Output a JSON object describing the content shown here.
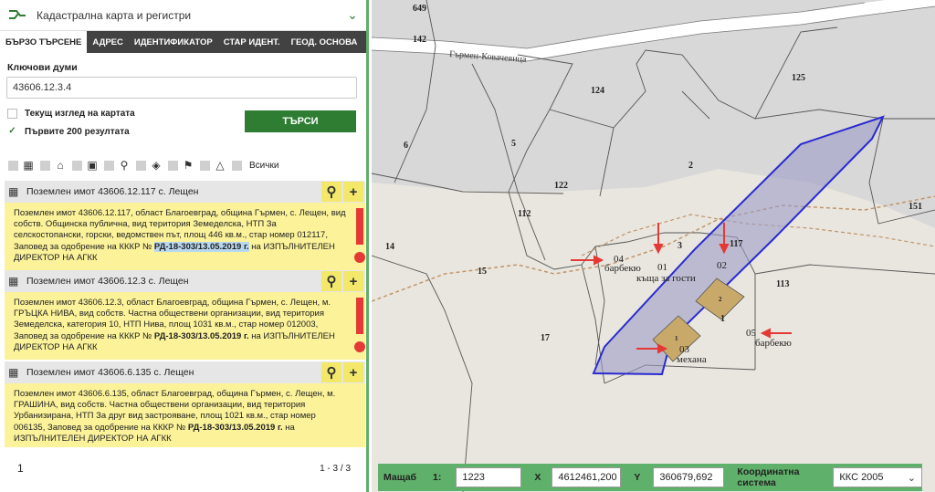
{
  "app": {
    "title": "Кадастрална карта и регистри"
  },
  "tabs": [
    "БЪРЗО ТЪРСЕНЕ",
    "АДРЕС",
    "ИДЕНТИФИКАТОР",
    "СТАР ИДЕНТ.",
    "ГЕОД. ОСНОВА"
  ],
  "search": {
    "keywords_label": "Ключови думи",
    "keywords_value": "43606.12.3.4",
    "current_view_label": "Текущ изглед на картата",
    "first200_label": "Първите 200 резултата",
    "button_label": "ТЪРСИ",
    "filter_all_label": "Всички"
  },
  "results": [
    {
      "title": "Поземлен имот 43606.12.117 с. Лещен",
      "text_a": "Поземлен имот 43606.12.117, област Благоевград, община Гърмен, с. Лещен, вид собств. Общинска публична, вид територия Земеделска, НТП За селскостопански, горски, ведомствен път, площ 446 кв.м., стар номер 012117, Заповед за одобрение на КККР № ",
      "order": "РД-18-303/13.05.2019 г.",
      "text_b": " на ИЗПЪЛНИТЕЛЕН ДИРЕКТОР НА АГКК"
    },
    {
      "title": "Поземлен имот 43606.12.3 с. Лещен",
      "text_a": "Поземлен имот 43606.12.3, област Благоевград, община Гърмен, с. Лещен, м. ГРЪЦКА НИВА, вид собств. Частна обществени организации, вид територия Земеделска, категория 10, НТП Нива, площ 1031 кв.м., стар номер 012003, Заповед за одобрение на КККР № ",
      "order": "РД-18-303/13.05.2019 г.",
      "text_b": " на ИЗПЪЛНИТЕЛЕН ДИРЕКТОР НА АГКК"
    },
    {
      "title": "Поземлен имот 43606.6.135 с. Лещен",
      "text_a": "Поземлен имот 43606.6.135, област Благоевград, община Гърмен, с. Лещен, м. ГРАШИНА, вид собств. Частна обществени организации, вид територия Урбанизирана, НТП За друг вид застрояване, площ 1021 кв.м., стар номер 006135, Заповед за одобрение на КККР № ",
      "order": "РД-18-303/13.05.2019 г.",
      "text_b": " на ИЗПЪЛНИТЕЛЕН ДИРЕКТОР НА АГКК"
    }
  ],
  "pager": {
    "page": "1",
    "range": "1 - 3 / 3"
  },
  "map": {
    "road_label": "Гърмен-Ковачевица",
    "parcel_labels": [
      "649",
      "142",
      "124",
      "125",
      "6",
      "5",
      "2",
      "122",
      "112",
      "14",
      "15",
      "3",
      "117",
      "113",
      "17",
      "151",
      "1",
      "2",
      "1"
    ],
    "annotations": {
      "a04": "04",
      "barbecue1": "барбекю",
      "a01": "01",
      "house": "къща за гости",
      "a02": "02",
      "a03": "03",
      "tavern": "механа",
      "a05": "05",
      "barbecue2": "барбекю"
    }
  },
  "scalebar": {
    "scale_label": "Мащаб",
    "scale_prefix": "1:",
    "scale_value": "1223",
    "x_label": "X",
    "x_value": "4612461,200",
    "y_label": "Y",
    "y_value": "360679,692",
    "crs_label": "Координатна система",
    "crs_value": "ККС 2005"
  },
  "colors": {
    "accent": "#2e7d32",
    "panel_border": "#5fb06a",
    "result_bg": "#fbf29a",
    "highlight": "#3333cc"
  }
}
